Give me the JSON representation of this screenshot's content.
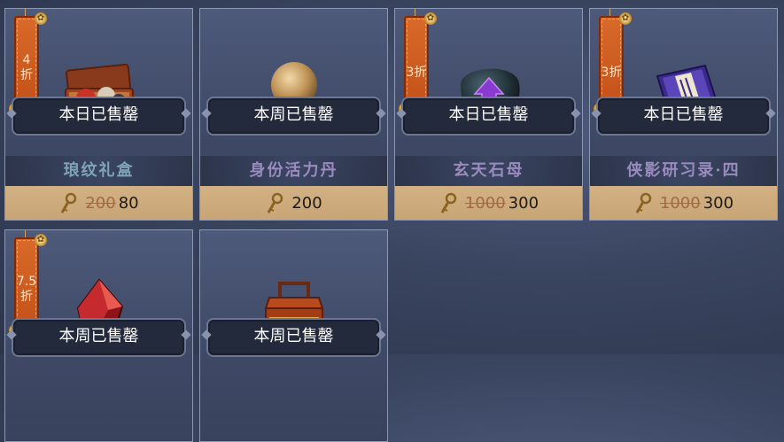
{
  "shop": {
    "items": [
      {
        "tag": "4\n折",
        "sold_label": "本日已售罄",
        "name": "琅纹礼盒",
        "name_color": "#7fa4b8",
        "old_price": "200",
        "price": "80",
        "icon": "gift-box-icon"
      },
      {
        "tag": "",
        "sold_label": "本周已售罄",
        "name": "身份活力丹",
        "name_color": "#9a8bbf",
        "old_price": "",
        "price": "200",
        "icon": "pill-orb-icon"
      },
      {
        "tag": "3折",
        "sold_label": "本日已售罄",
        "name": "玄天石母",
        "name_color": "#9a8bbf",
        "old_price": "1000",
        "price": "300",
        "icon": "black-stone-icon"
      },
      {
        "tag": "3折",
        "sold_label": "本日已售罄",
        "name": "侠影研习录·四",
        "name_color": "#9a8bbf",
        "old_price": "1000",
        "price": "300",
        "icon": "scroll-book-icon"
      },
      {
        "tag": "7.5\n折",
        "sold_label": "本周已售罄",
        "icon": "red-crystal-icon"
      },
      {
        "tag": "",
        "sold_label": "本周已售罄",
        "icon": "lacquer-box-icon"
      }
    ]
  },
  "colors": {
    "tag": "#c95619",
    "price_bar": "#cfac7e",
    "strike": "#a46a45"
  }
}
